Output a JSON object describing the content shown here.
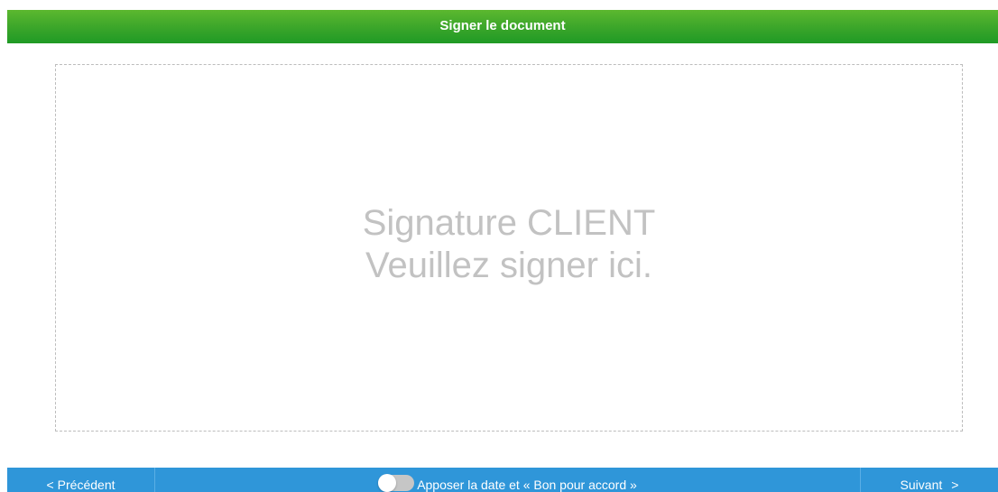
{
  "header": {
    "title": "Signer le document",
    "color": "#3aa52a"
  },
  "signature_pad": {
    "line1": "Signature CLIENT",
    "line2": "Veuillez signer ici."
  },
  "footer": {
    "color": "#2f96d9",
    "prev": {
      "icon": "chevron-left-icon",
      "glyph": "<",
      "label": "Précédent"
    },
    "toggle": {
      "label": "Apposer la date et « Bon pour accord »",
      "checked": false
    },
    "next": {
      "label": "Suivant",
      "icon": "chevron-right-icon",
      "glyph": ">"
    }
  }
}
